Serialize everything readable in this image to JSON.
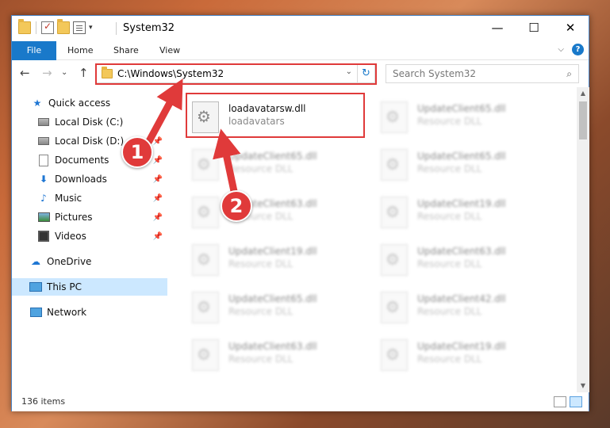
{
  "window": {
    "title": "System32",
    "controls": {
      "minimize": "—",
      "maximize": "☐",
      "close": "✕"
    }
  },
  "ribbon": {
    "tabs": [
      {
        "label": "File"
      },
      {
        "label": "Home"
      },
      {
        "label": "Share"
      },
      {
        "label": "View"
      }
    ],
    "expand_chevron": "⌵",
    "help": "?"
  },
  "nav": {
    "back": "←",
    "forward": "→",
    "recent": "⌄",
    "up": "↑",
    "address": "C:\\Windows\\System32",
    "address_dropdown": "⌄",
    "refresh": "↻",
    "search_placeholder": "Search System32",
    "search_icon": "⌕"
  },
  "sidebar": {
    "items": [
      {
        "label": "Quick access",
        "icon": "star-icon",
        "pinned": false
      },
      {
        "label": "Local Disk (C:)",
        "icon": "drive-icon",
        "pinned": false
      },
      {
        "label": "Local Disk (D:)",
        "icon": "drive-icon",
        "pinned": true
      },
      {
        "label": "Documents",
        "icon": "documents-icon",
        "pinned": true
      },
      {
        "label": "Downloads",
        "icon": "downloads-icon",
        "pinned": true
      },
      {
        "label": "Music",
        "icon": "music-icon",
        "pinned": true
      },
      {
        "label": "Pictures",
        "icon": "pictures-icon",
        "pinned": true
      },
      {
        "label": "Videos",
        "icon": "videos-icon",
        "pinned": true
      },
      {
        "label": "OneDrive",
        "icon": "onedrive-icon",
        "pinned": false
      },
      {
        "label": "This PC",
        "icon": "this-pc-icon",
        "pinned": false,
        "selected": true
      },
      {
        "label": "Network",
        "icon": "network-icon",
        "pinned": false
      }
    ],
    "pin_glyph": "📌"
  },
  "files": {
    "left": [
      {
        "name": "loadavatarsw.dll",
        "desc": "loadavatars",
        "highlighted": true
      },
      {
        "name": "UpdateClient65.dll",
        "desc": "Resource DLL"
      },
      {
        "name": "UpdateClient63.dll",
        "desc": "Resource DLL"
      },
      {
        "name": "UpdateClient19.dll",
        "desc": "Resource DLL"
      },
      {
        "name": "UpdateClient65.dll",
        "desc": "Resource DLL"
      },
      {
        "name": "UpdateClient63.dll",
        "desc": "Resource DLL"
      }
    ],
    "right": [
      {
        "name": "UpdateClient65.dll",
        "desc": "Resource DLL"
      },
      {
        "name": "UpdateClient65.dll",
        "desc": "Resource DLL"
      },
      {
        "name": "UpdateClient19.dll",
        "desc": "Resource DLL"
      },
      {
        "name": "UpdateClient63.dll",
        "desc": "Resource DLL"
      },
      {
        "name": "UpdateClient42.dll",
        "desc": "Resource DLL"
      },
      {
        "name": "UpdateClient19.dll",
        "desc": "Resource DLL"
      }
    ]
  },
  "status": {
    "items": "136 items"
  },
  "annotations": {
    "step1": "1",
    "step2": "2",
    "color": "#e03a3a"
  }
}
